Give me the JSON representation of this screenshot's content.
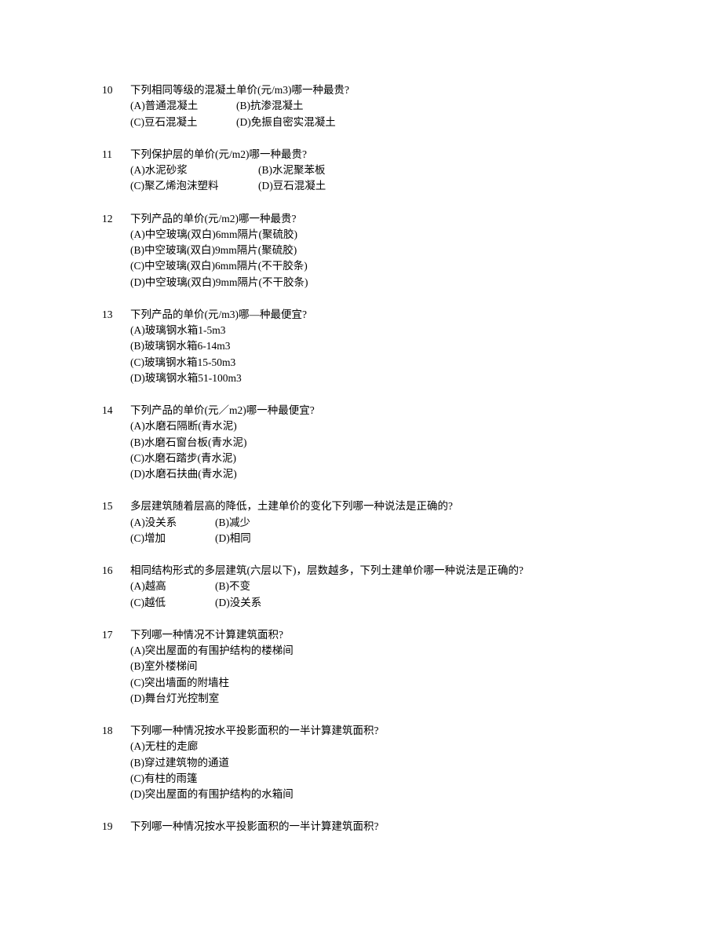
{
  "questions": [
    {
      "num": "10",
      "text": "下列相同等级的混凝土单价(元/m3)哪一种最贵?",
      "layout": "2col",
      "col1Width": "135px",
      "options": [
        [
          "(A)普通混凝土",
          "(B)抗渗混凝土"
        ],
        [
          "(C)豆石混凝土",
          "(D)免振自密实混凝土"
        ]
      ]
    },
    {
      "num": "11",
      "text": "下列保护层的单价(元/m2)哪一种最贵?",
      "layout": "2col",
      "col1Width": "163px",
      "options": [
        [
          "(A)水泥砂浆",
          "(B)水泥聚苯板"
        ],
        [
          "(C)聚乙烯泡沫塑料",
          "(D)豆石混凝土"
        ]
      ]
    },
    {
      "num": "12",
      "text": "下列产品的单价(元/m2)哪一种最贵?",
      "layout": "block",
      "options": [
        "(A)中空玻璃(双白)6mm隔片(聚硫胶)",
        "(B)中空玻璃(双白)9mm隔片(聚硫胶)",
        "(C)中空玻璃(双白)6mm隔片(不干胶条)",
        "(D)中空玻璃(双白)9mm隔片(不干胶条)"
      ]
    },
    {
      "num": "13",
      "text": "下列产品的单价(元/m3)哪—种最便宜?",
      "layout": "block",
      "options": [
        "(A)玻璃钢水箱1-5m3",
        "(B)玻璃钢水箱6-14m3",
        "(C)玻璃钢水箱15-50m3",
        "(D)玻璃钢水箱51-100m3"
      ]
    },
    {
      "num": "14",
      "text": "下列产品的单价(元／m2)哪一种最便宜?",
      "layout": "block",
      "options": [
        "(A)水磨石隔断(青水泥)",
        "(B)水磨石窗台板(青水泥)",
        "(C)水磨石踏步(青水泥)",
        "(D)水磨石扶曲(青水泥)"
      ]
    },
    {
      "num": "15",
      "text": "多层建筑随着层高的降低，土建单价的变化下列哪一种说法是正确的?",
      "layout": "2col",
      "col1Width": "108px",
      "options": [
        [
          "(A)没关系",
          "(B)减少"
        ],
        [
          "(C)增加",
          "(D)相同"
        ]
      ]
    },
    {
      "num": "16",
      "text": "相同结构形式的多层建筑(六层以下)，层数越多，下列土建单价哪一种说法是正确的?",
      "layout": "2col",
      "col1Width": "108px",
      "options": [
        [
          "(A)越高",
          "(B)不变"
        ],
        [
          "(C)越低",
          "(D)没关系"
        ]
      ]
    },
    {
      "num": "17",
      "text": "下列哪一种情况不计算建筑面积?",
      "layout": "block",
      "options": [
        "(A)突出屋面的有围护结构的楼梯间",
        "(B)室外楼梯间",
        "(C)突出墙面的附墙柱",
        "(D)舞台灯光控制室"
      ]
    },
    {
      "num": "18",
      "text": "下列哪一种情况按水平投影面积的一半计算建筑面积?",
      "layout": "block",
      "options": [
        "(A)无柱的走廊",
        "(B)穿过建筑物的通道",
        "(C)有柱的雨篷",
        "(D)突出屋面的有围护结构的水箱间"
      ]
    },
    {
      "num": "19",
      "text": "下列哪一种情况按水平投影面积的一半计算建筑面积?",
      "layout": "block",
      "options": []
    }
  ]
}
